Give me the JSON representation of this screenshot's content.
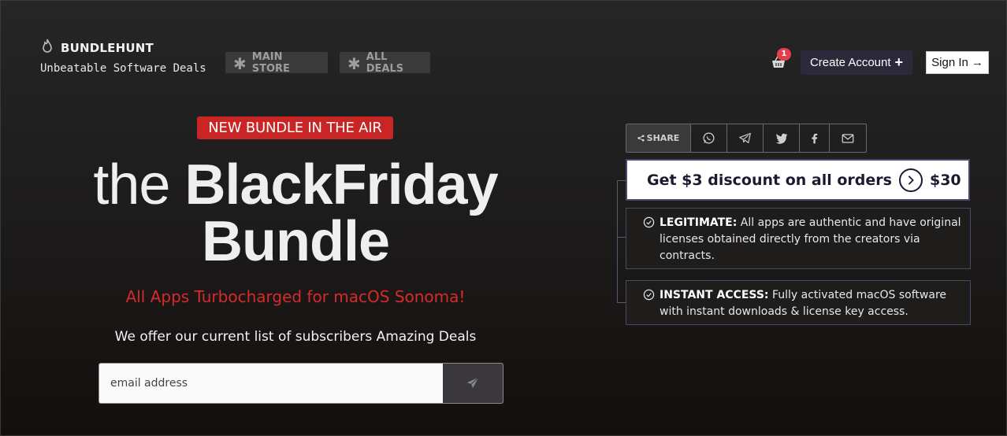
{
  "brand": {
    "name": "BUNDLEHUNT",
    "tagline": "Unbeatable Software Deals",
    "icon": "flame-icon"
  },
  "nav": {
    "main_store": "MAIN STORE",
    "all_deals": "ALL DEALS"
  },
  "header": {
    "cart_count": "1",
    "create_account": "Create Account",
    "sign_in": "Sign In",
    "create_icon": "+",
    "signin_icon": "→"
  },
  "hero": {
    "badge": "NEW BUNDLE IN THE AIR",
    "title_prefix": "the ",
    "title_bold_1": "BlackFriday",
    "title_bold_2": "Bundle",
    "subtitle": "All Apps Turbocharged for macOS Sonoma!",
    "offer_text": "We offer our current list of subscribers Amazing Deals",
    "email_placeholder": "email address"
  },
  "share": {
    "label": "SHARE",
    "icons": [
      "whatsapp-icon",
      "telegram-icon",
      "twitter-icon",
      "facebook-icon",
      "mail-icon"
    ]
  },
  "discount": {
    "text": "Get $3 discount on all orders",
    "amount": "$30"
  },
  "features": [
    {
      "title": "LEGITIMATE:",
      "text": " All apps are authentic and have original licenses obtained directly from the creators via contracts."
    },
    {
      "title": "INSTANT ACCESS:",
      "text": " Fully activated macOS software with instant downloads & license key access."
    }
  ],
  "colors": {
    "accent_red": "#c92525",
    "subtitle_red": "#d62b2b",
    "badge_red": "#e63e4d",
    "button_dark": "#2a2a3a",
    "border_purple": "#4a4768"
  }
}
